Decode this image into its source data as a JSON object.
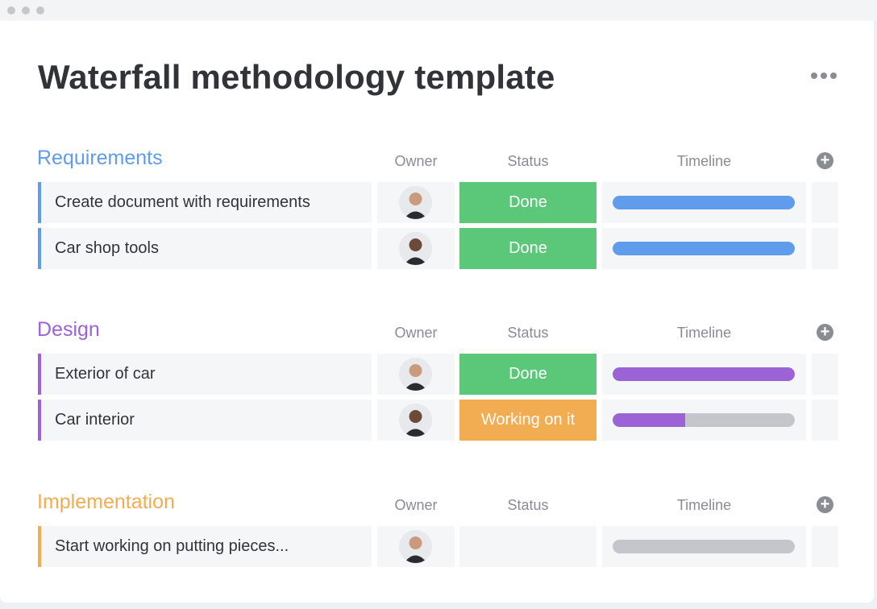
{
  "window": {
    "title": "Waterfall methodology template",
    "more_icon": "more-horizontal-icon"
  },
  "columns": {
    "owner": "Owner",
    "status": "Status",
    "timeline": "Timeline",
    "add_icon": "plus-circle-icon"
  },
  "colors": {
    "done": "#5bc778",
    "working": "#f2ac52",
    "blue": "#5f9cec",
    "purple": "#9b63d6",
    "orange": "#f2ac52",
    "empty": "#c4c6cc"
  },
  "groups": [
    {
      "title": "Requirements",
      "color": "#5f9cec",
      "items": [
        {
          "name": "Create document with requirements",
          "owner": "woman-curly-hair",
          "status": "Done",
          "status_color": "#5bc778",
          "timeline_progress": 1.0,
          "timeline_color": "#5f9cec"
        },
        {
          "name": "Car shop tools",
          "owner": "man-bald-beard",
          "status": "Done",
          "status_color": "#5bc778",
          "timeline_progress": 1.0,
          "timeline_color": "#5f9cec"
        }
      ]
    },
    {
      "title": "Design",
      "color": "#9b63d6",
      "items": [
        {
          "name": "Exterior of car",
          "owner": "man-short-hair",
          "status": "Done",
          "status_color": "#5bc778",
          "timeline_progress": 1.0,
          "timeline_color": "#9b63d6"
        },
        {
          "name": "Car interior",
          "owner": "man-bald-beard",
          "status": "Working on it",
          "status_color": "#f2ac52",
          "timeline_progress": 0.4,
          "timeline_color": "#9b63d6"
        }
      ]
    },
    {
      "title": "Implementation",
      "color": "#f2ac52",
      "items": [
        {
          "name": "Start working on putting pieces...",
          "owner": "man-short-hair",
          "status": "",
          "status_color": "#f5f6f8",
          "timeline_progress": 0.0,
          "timeline_color": "#c4c6cc"
        }
      ]
    }
  ]
}
